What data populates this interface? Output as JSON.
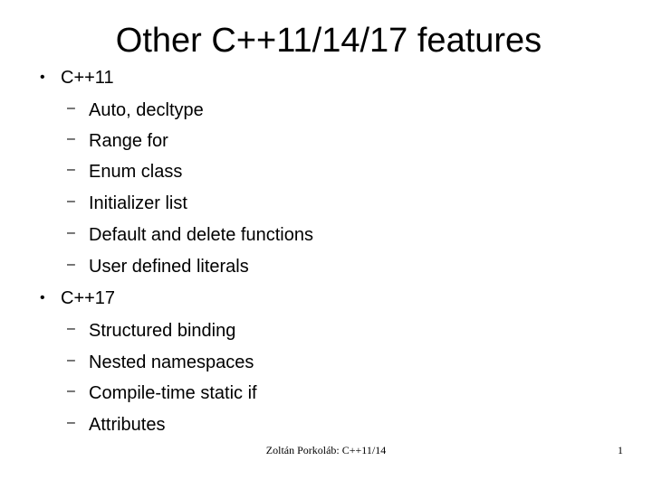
{
  "slide": {
    "title": "Other C++11/14/17 features",
    "sections": [
      {
        "heading": "C++11",
        "items": [
          "Auto, decltype",
          "Range for",
          "Enum class",
          "Initializer list",
          "Default and delete functions",
          "User defined literals"
        ]
      },
      {
        "heading": "C++17",
        "items": [
          "Structured binding",
          "Nested namespaces",
          "Compile-time static if",
          "Attributes"
        ]
      }
    ],
    "bullet_glyph": "•",
    "dash_glyph": "–"
  },
  "footer": {
    "text": "Zoltán Porkoláb: C++11/14",
    "page_number": "1"
  }
}
